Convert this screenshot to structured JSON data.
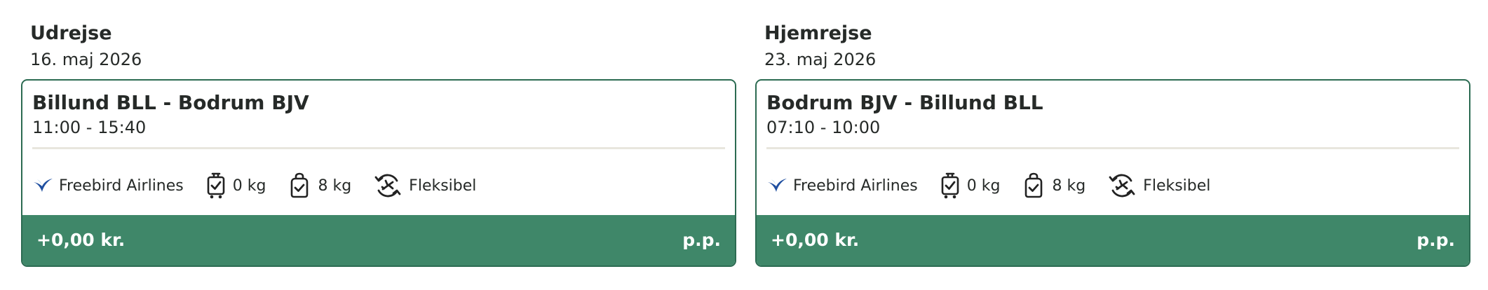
{
  "outbound": {
    "title": "Udrejse",
    "date": "16. maj 2026",
    "route": "Billund BLL - Bodrum BJV",
    "time": "11:00 - 15:40",
    "airline": "Freebird Airlines",
    "checked_baggage": "0 kg",
    "hand_baggage": "8 kg",
    "flex": "Fleksibel",
    "price": "+0,00 kr.",
    "per_person": "p.p."
  },
  "return": {
    "title": "Hjemrejse",
    "date": "23. maj 2026",
    "route": "Bodrum BJV - Billund BLL",
    "time": "07:10 - 10:00",
    "airline": "Freebird Airlines",
    "checked_baggage": "0 kg",
    "hand_baggage": "8 kg",
    "flex": "Fleksibel",
    "price": "+0,00 kr.",
    "per_person": "p.p."
  },
  "icons": {
    "airline": "freebird-logo-icon",
    "checked_baggage": "suitcase-check-icon",
    "hand_baggage": "bag-check-icon",
    "flex": "plane-refresh-icon"
  },
  "colors": {
    "card_border": "#2c6b52",
    "price_bar": "#3f8769",
    "airline_logo": "#1f4fa0"
  }
}
